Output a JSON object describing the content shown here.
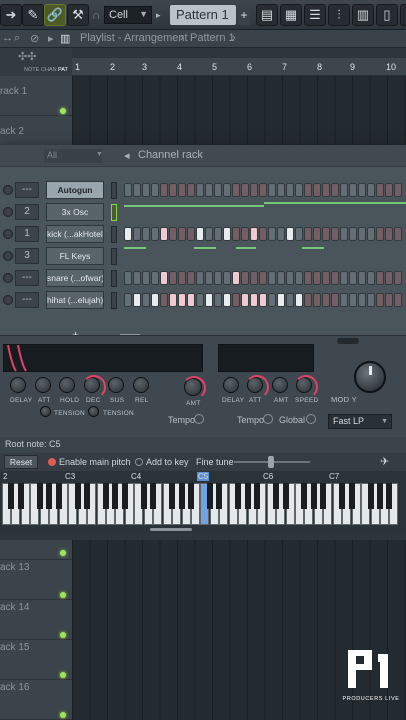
{
  "toolbar": {
    "snap_value": "Cell",
    "pattern_name": "Pattern 1",
    "pattern_add": "+"
  },
  "playlist": {
    "title": "Playlist - Arrangement",
    "pattern_crumb": "Pattern 1",
    "sub_tabs": [
      "NOTE",
      "CHAN",
      "PAT"
    ],
    "ruler": [
      "1",
      "2",
      "3",
      "4",
      "5",
      "6",
      "7",
      "8",
      "9",
      "10"
    ],
    "top_tracks": [
      "rack 1",
      "ack 2"
    ],
    "bottom_tracks": [
      "ack 13",
      "ack 14",
      "ack 15",
      "ack 16"
    ]
  },
  "channel_rack": {
    "filter": "All",
    "title": "Channel rack",
    "add_label": "+",
    "channels": [
      {
        "num": "---",
        "name": "Autogun",
        "selected": true,
        "mode": "graph"
      },
      {
        "num": "2",
        "name": "3x Osc",
        "selected": false,
        "mode": "graph"
      },
      {
        "num": "1",
        "name": "kick (...akHotel)",
        "selected": false,
        "mode": "steps"
      },
      {
        "num": "3",
        "name": "FL Keys",
        "selected": false,
        "mode": "graph"
      },
      {
        "num": "---",
        "name": "snare (...ofwar)",
        "selected": false,
        "mode": "steps"
      },
      {
        "num": "---",
        "name": "hihat (...elujah)",
        "selected": false,
        "mode": "steps"
      }
    ]
  },
  "instrument": {
    "knobs_row1": [
      "DELAY",
      "ATT",
      "HOLD",
      "DEC",
      "SUS",
      "REL"
    ],
    "tension": [
      "TENSION",
      "TENSION"
    ],
    "amt": "AMT",
    "tempo_left": "Tempo",
    "knobs_row2": [
      "DELAY",
      "ATT",
      "AMT",
      "SPEED"
    ],
    "tempo_right": "Tempo",
    "global": "Global",
    "mod_y": "MOD Y",
    "filter_type": "Fast LP"
  },
  "keyboard": {
    "root_note": "Root note: C5",
    "reset": "Reset",
    "enable_pitch": "Enable main pitch",
    "add_to_key": "Add to key",
    "fine_tune": "Fine tune",
    "octaves": [
      "2",
      "C3",
      "C4",
      "C5",
      "C6",
      "C7"
    ]
  },
  "logo": {
    "tagline": "PRODUCERS LIVE"
  }
}
